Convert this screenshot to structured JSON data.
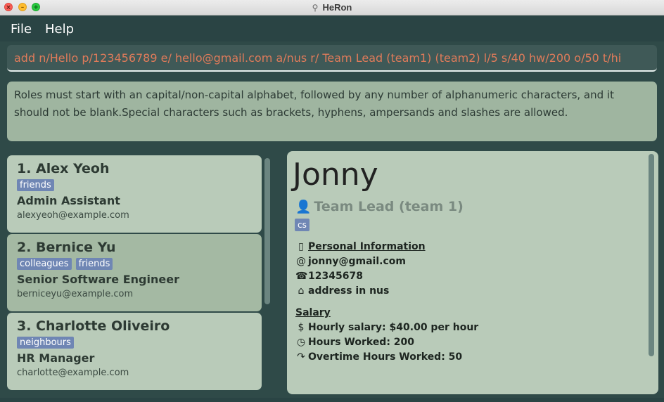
{
  "window": {
    "title": "HeRon"
  },
  "menu": {
    "file": "File",
    "help": "Help"
  },
  "command": {
    "value": "add n/Hello p/123456789 e/ hello@gmail.com a/nus r/ Team Lead (team1) (team2) l/5 s/40 hw/200 o/50 t/hi"
  },
  "result": {
    "message": "Roles must start with an capital/non-capital alphabet, followed by any number of alphanumeric characters, and it should not be blank.Special characters such as brackets, hyphens, ampersands and slashes are allowed."
  },
  "persons": [
    {
      "index_name": "1.  Alex Yeoh",
      "tags": [
        "friends"
      ],
      "role": "Admin Assistant",
      "email": "alexyeoh@example.com"
    },
    {
      "index_name": "2.  Bernice Yu",
      "tags": [
        "colleagues",
        "friends"
      ],
      "role": "Senior Software Engineer",
      "email": "berniceyu@example.com"
    },
    {
      "index_name": "3.  Charlotte Oliveiro",
      "tags": [
        "neighbours"
      ],
      "role": "HR Manager",
      "email": "charlotte@example.com"
    }
  ],
  "detail": {
    "name": "Jonny",
    "role": "Team Lead (team 1)",
    "tag": "cs",
    "personal_heading": "Personal Information",
    "email": "jonny@gmail.com",
    "phone": "12345678",
    "address": "address in nus",
    "salary_heading": "Salary",
    "hourly_salary": "Hourly salary: $40.00 per hour",
    "hours_worked": "Hours Worked: 200",
    "overtime": "Overtime Hours Worked: 50"
  },
  "icons": {
    "person": "person-icon",
    "personal_info": "id-card-icon",
    "email": "at-icon",
    "phone": "phone-icon",
    "address": "house-icon",
    "salary": "dollar-icon",
    "hours": "clock-icon",
    "overtime": "arrow-icon"
  },
  "colors": {
    "background": "#2f4a48",
    "command_text": "#e07b5a",
    "tag": "#6f86b4",
    "card": "#b9cbb9"
  }
}
